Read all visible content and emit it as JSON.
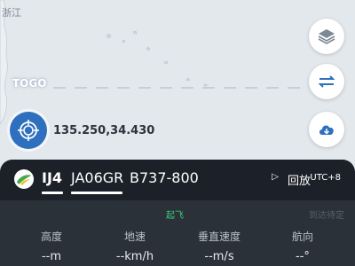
{
  "map": {
    "region_label": "浙江",
    "waypoint_label": "TOGO",
    "coordinates": "135.250,34.430"
  },
  "controls": {
    "layers_icon": "layers-icon",
    "swap_icon": "swap-arrows-icon",
    "cloud_icon": "cloud-download-icon",
    "locate_icon": "crosshair-target-icon"
  },
  "flight": {
    "number": "IJ4",
    "registration": "JA06GR",
    "aircraft_type": "B737-800",
    "replay_label": "回放",
    "timezone": "UTC+8",
    "status_left": "起飞",
    "status_right": "到达待定"
  },
  "metrics": [
    {
      "label": "高度",
      "value": "--m"
    },
    {
      "label": "地速",
      "value": "--km/h"
    },
    {
      "label": "垂直速度",
      "value": "--m/s"
    },
    {
      "label": "航向",
      "value": "--°"
    }
  ],
  "colors": {
    "panel_dark": "#1c2028",
    "panel_body": "#2b3139",
    "accent_blue": "#2e6fbe",
    "status_green": "#3bd07a"
  }
}
